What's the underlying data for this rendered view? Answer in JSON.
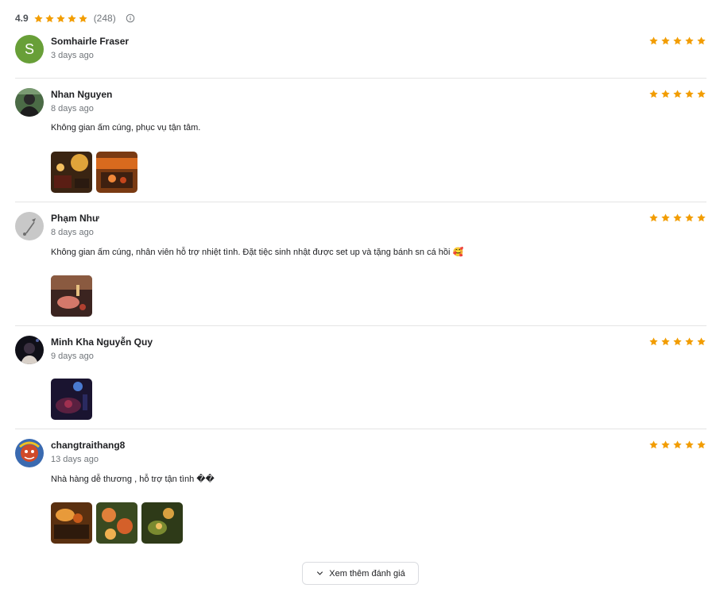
{
  "summary": {
    "score": "4.9",
    "rating": 5,
    "count": "(248)"
  },
  "colors": {
    "star": "#f29d00",
    "divider": "#e4e4e4",
    "avatar_s": "#689f38"
  },
  "reviews": [
    {
      "name": "Somhairle Fraser",
      "date": "3 days ago",
      "rating": 5,
      "text": "",
      "avatar": "letter",
      "avatar_letter": "S"
    },
    {
      "name": "Nhan Nguyen",
      "date": "8 days ago",
      "rating": 5,
      "text": "Không gian ấm cúng, phục vụ tận tâm.",
      "avatar": "photo",
      "photos": 2
    },
    {
      "name": "Phạm Như",
      "date": "8 days ago",
      "rating": 5,
      "text": "Không gian ấm cúng, nhân viên hỗ trợ nhiệt tình. Đặt tiệc sinh nhật được set up và tặng bánh sn cá hồi 🥰",
      "avatar": "default",
      "photos": 1
    },
    {
      "name": "Minh Kha Nguyễn Quy",
      "date": "9 days ago",
      "rating": 5,
      "text": "",
      "avatar": "photo",
      "photos": 1
    },
    {
      "name": "changtraithang8",
      "date": "13 days ago",
      "rating": 5,
      "text": "Nhà hàng dễ thương , hỗ trợ tận tình ��",
      "avatar": "photo",
      "photos": 3
    }
  ],
  "more_button": {
    "label": "Xem thêm đánh giá",
    "icon": "chevron-down-icon"
  }
}
